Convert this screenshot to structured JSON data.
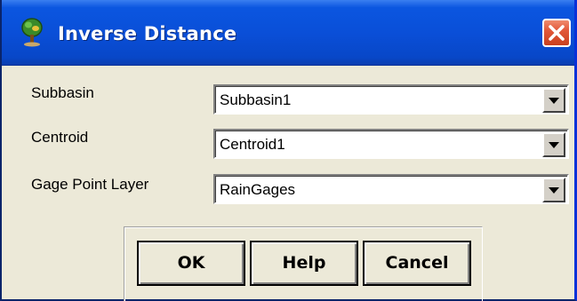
{
  "window": {
    "title": "Inverse Distance",
    "title_icon": "tree-icon",
    "close_icon": "close-icon",
    "titlebar_color": "#0a4fd8",
    "close_color": "#d9533a"
  },
  "fields": [
    {
      "label": "Subbasin",
      "value": "Subbasin1"
    },
    {
      "label": "Centroid",
      "value": "Centroid1"
    },
    {
      "label": "Gage Point Layer",
      "value": "RainGages"
    }
  ],
  "buttons": {
    "ok": "OK",
    "help": "Help",
    "cancel": "Cancel"
  }
}
